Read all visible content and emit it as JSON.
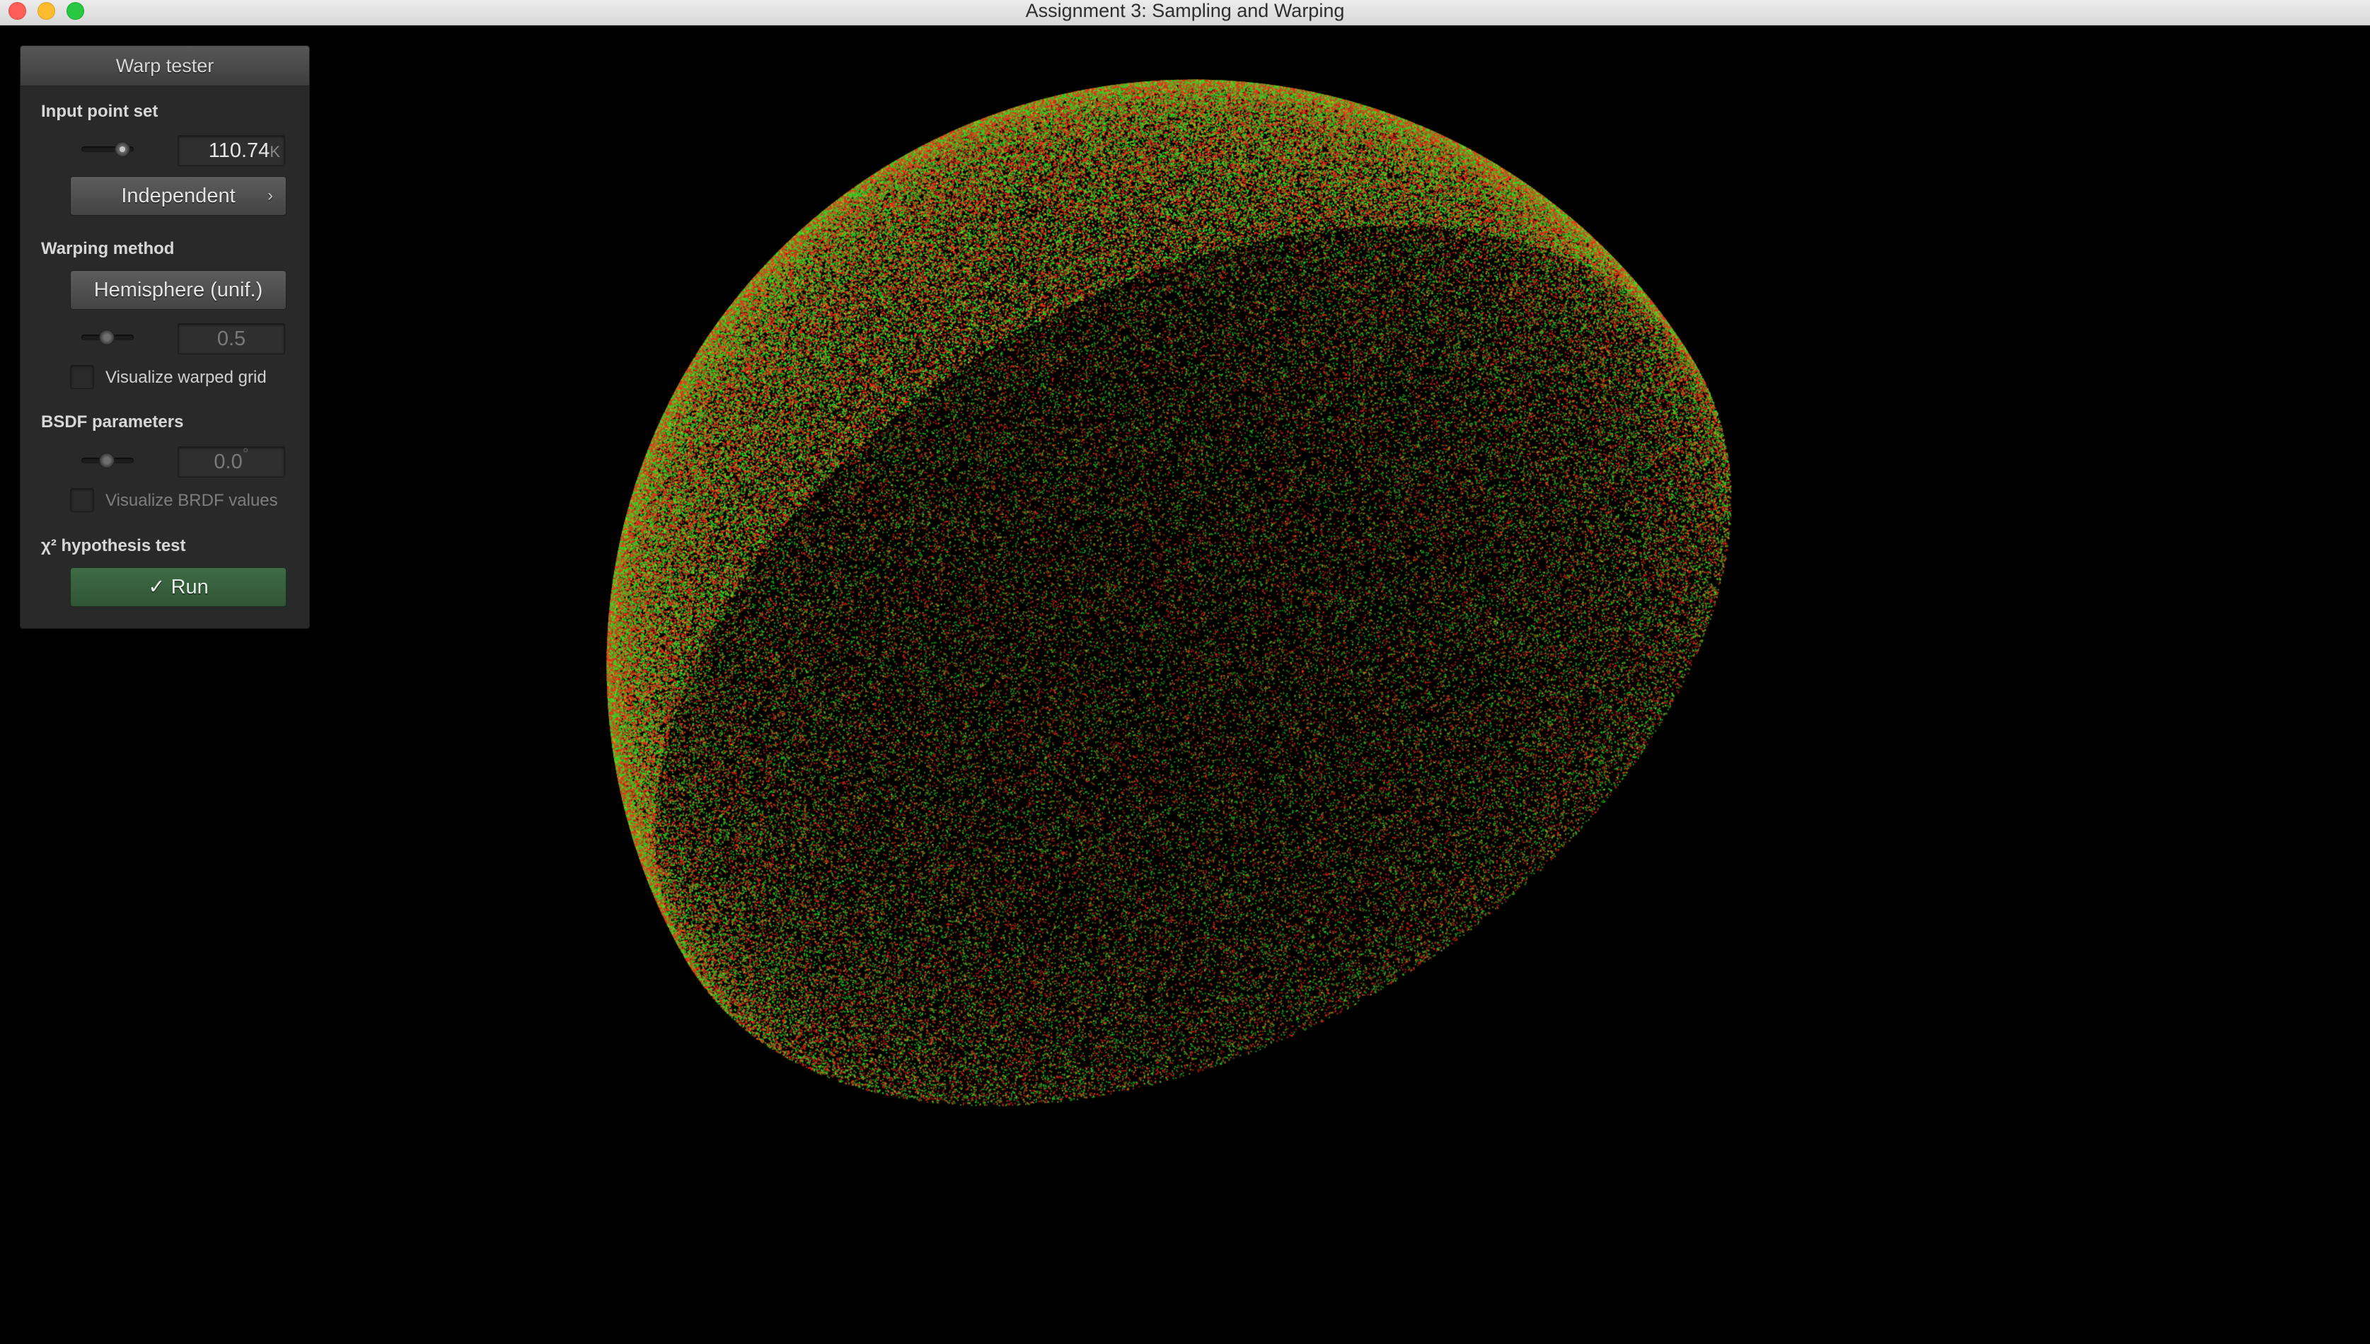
{
  "window": {
    "title": "Assignment 3: Sampling and Warping"
  },
  "panel": {
    "title": "Warp tester",
    "input_point_set": {
      "label": "Input point set",
      "count_value": "110.74",
      "count_unit": "K",
      "mode_button": "Independent",
      "mode_chevron": "›"
    },
    "warping_method": {
      "label": "Warping method",
      "selected": "Hemisphere (unif.)",
      "parameter_value": "0.5",
      "visualize_grid_label": "Visualize warped grid",
      "visualize_grid_checked": false
    },
    "bsdf_parameters": {
      "label": "BSDF parameters",
      "angle_value": "0.0",
      "angle_unit": "°",
      "visualize_brdf_label": "Visualize BRDF values",
      "visualize_brdf_checked": false
    },
    "hypothesis_test": {
      "label": "χ² hypothesis test",
      "run_button": "✓ Run"
    }
  },
  "visualization": {
    "shape": "hemisphere",
    "point_colors": [
      "#f02d1a",
      "#2fd82a",
      "#b4c61e",
      "#ff6a20"
    ],
    "background": "#000000"
  }
}
